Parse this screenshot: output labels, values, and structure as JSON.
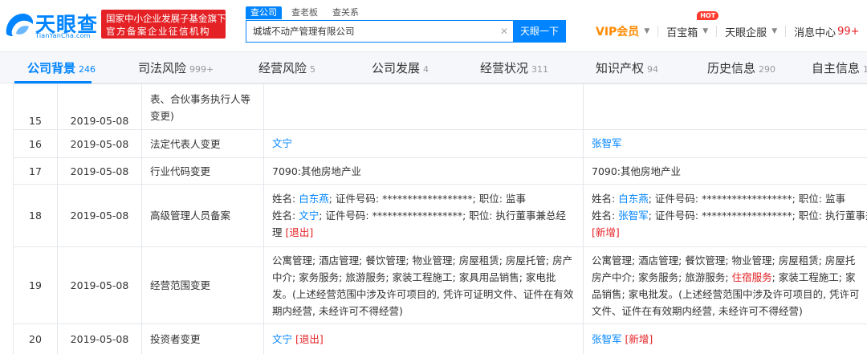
{
  "header": {
    "logo_text": "天眼查",
    "logo_sub": "TianYanCha.com",
    "gov_badge_line1": "国家中小企业发展子基金旗下",
    "gov_badge_line2": "官方备案企业征信机构",
    "search_tabs": [
      "查公司",
      "查老板",
      "查关系"
    ],
    "search_value": "城城不动产管理有限公司",
    "search_button": "天眼一下",
    "nav": {
      "vip": "VIP会员",
      "hot_badge": "HOT",
      "treasure": "百宝箱",
      "enterprise": "天眼企服",
      "messages": "消息中心",
      "messages_count": "99+"
    }
  },
  "tabs": [
    {
      "label": "公司背景",
      "count": "246"
    },
    {
      "label": "司法风险",
      "count": "999+"
    },
    {
      "label": "经营风险",
      "count": "5"
    },
    {
      "label": "公司发展",
      "count": "4"
    },
    {
      "label": "经营状况",
      "count": "311"
    },
    {
      "label": "知识产权",
      "count": "94"
    },
    {
      "label": "历史信息",
      "count": "290"
    },
    {
      "label": "自主信息",
      "count": "12"
    }
  ],
  "rows": [
    {
      "index": "15",
      "date": "2019-05-08",
      "item_tail": [
        "表、合伙事务执行人等",
        "变更)"
      ]
    },
    {
      "index": "16",
      "date": "2019-05-08",
      "item": "法定代表人变更",
      "before": "文宁",
      "after": "张智军"
    },
    {
      "index": "17",
      "date": "2019-05-08",
      "item": "行业代码变更",
      "before": "7090:其他房地产业",
      "after": "7090:其他房地产业"
    },
    {
      "index": "18",
      "date": "2019-05-08",
      "item": "高级管理人员备案",
      "before": {
        "p1_prefix": "姓名: ",
        "p1_name": "白东燕",
        "p1_rest": "; 证件号码: ******************; 职位: 监事",
        "p2_prefix": "姓名: ",
        "p2_name": "文宁",
        "p2_rest": "; 证件号码: ******************; 职位: 执行董事兼总经理 ",
        "p2_mark": "[退出]"
      },
      "after": {
        "p1_prefix": "姓名: ",
        "p1_name": "白东燕",
        "p1_rest": "; 证件号码: ******************; 职位: 监事",
        "p2_prefix": "姓名: ",
        "p2_name": "张智军",
        "p2_rest": "; 证件号码: ******************; 职位: 执行董事兼总经",
        "p2_mark": "[新增]"
      }
    },
    {
      "index": "19",
      "date": "2019-05-08",
      "item": "经营范围变更",
      "before": "公寓管理; 酒店管理; 餐饮管理; 物业管理; 房屋租赁; 房屋托管; 房产中介; 家务服务; 旅游服务; 家装工程施工; 家具用品销售; 家电批发。(上述经营范围中涉及许可项目的, 凭许可证明文件、证件在有效期内经营, 未经许可不得经营)",
      "after_lines": [
        {
          "text": "公寓管理; 酒店管理; 餐饮管理; 物业管理; 房屋租赁; 房屋托",
          "hl": ""
        },
        {
          "pre": "房产中介; 家务服务; 旅游服务; ",
          "hl": "住宿服务",
          "post": "; 家装工程施工; 家"
        },
        {
          "text": "品销售; 家电批发。(上述经营范围中涉及许可项目的, 凭许可",
          "hl": ""
        },
        {
          "text": "文件、证件在有效期内经营, 未经许可不得经营)",
          "hl": ""
        }
      ]
    },
    {
      "index": "20",
      "date": "2019-05-08",
      "item": "投资者变更",
      "before_name": "文宁",
      "before_mark": "[退出]",
      "after_name": "张智军",
      "after_mark": "[新增]"
    }
  ],
  "colors": {
    "brand_blue": "#0084ff",
    "badge_red": "#e42226",
    "vip_orange": "#ff8a00"
  }
}
